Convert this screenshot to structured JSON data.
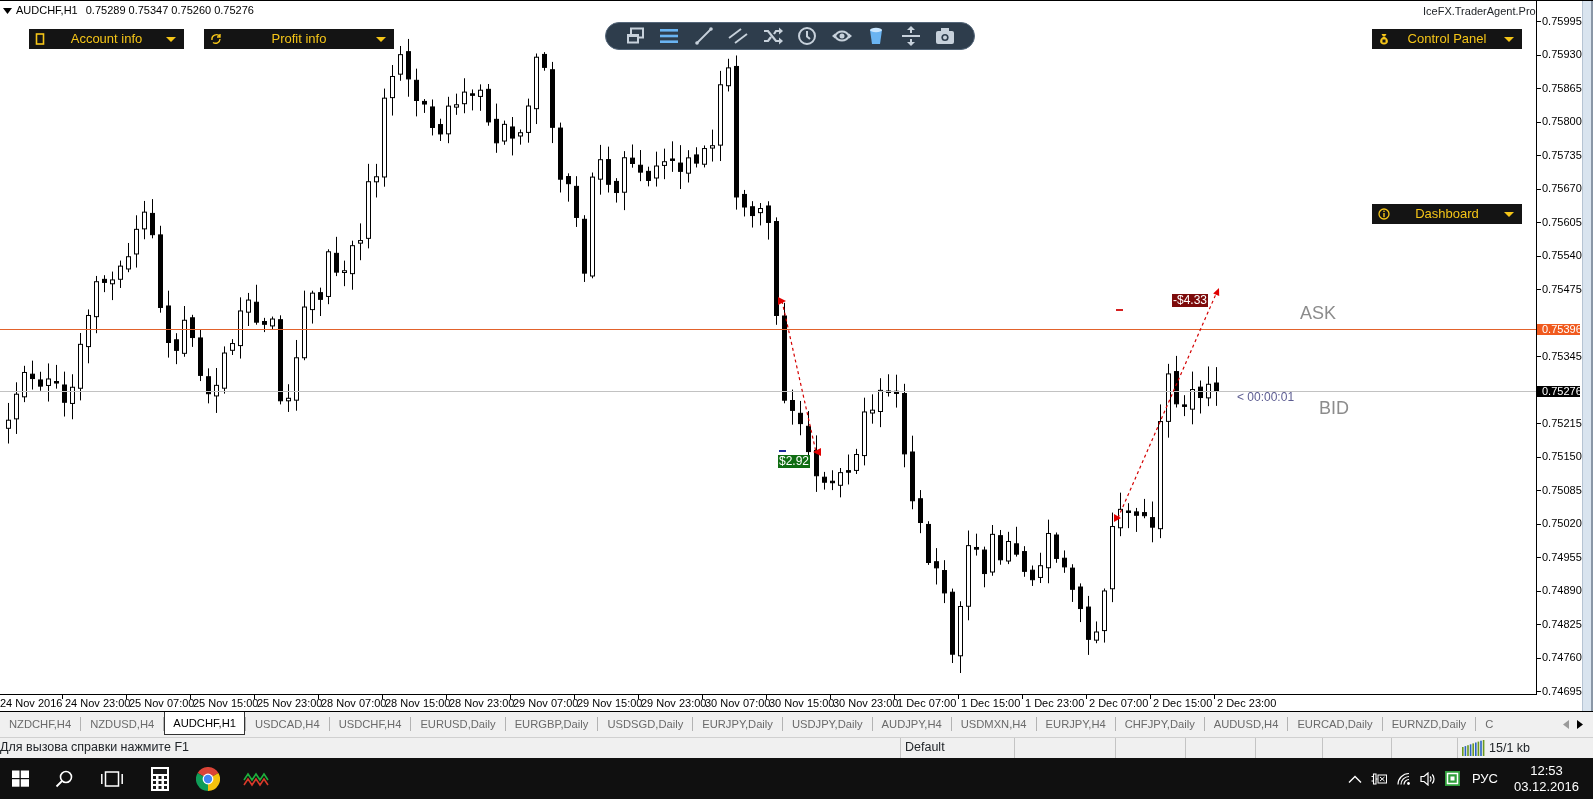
{
  "chart": {
    "symbol": "AUDCHF,H1",
    "quotes": [
      "0.75289",
      "0.75347",
      "0.75260",
      "0.75276"
    ],
    "left_panels": [
      {
        "label": "Account info"
      },
      {
        "label": "Profit info"
      }
    ],
    "toolbar": [
      {
        "active": false
      },
      {
        "active": true
      },
      {
        "active": false
      },
      {
        "active": false
      },
      {
        "active": false
      },
      {
        "active": false
      },
      {
        "active": false
      },
      {
        "active": true
      },
      {
        "active": false
      },
      {
        "active": false
      }
    ],
    "brand": "IceFX.TraderAgent.Pro",
    "right_panels": [
      {
        "label": "Control Panel"
      },
      {
        "label": "Dashboard"
      }
    ],
    "ask": {
      "label": "ASK",
      "price": "0.75396"
    },
    "bid": {
      "label": "BID",
      "price": "0.75276",
      "countdown": "< 00:00:01"
    },
    "trades": [
      {
        "profit": "$2.92",
        "color": "#0f6d12"
      },
      {
        "profit": "-$4.33",
        "color": "#7d0b0b"
      }
    ],
    "price_axis": [
      "0.75995",
      "0.75930",
      "0.75865",
      "0.75800",
      "0.75735",
      "0.75670",
      "0.75605",
      "0.75540",
      "0.75475",
      "0.75345",
      "0.75215",
      "0.75150",
      "0.75085",
      "0.75020",
      "0.74955",
      "0.74890",
      "0.74825",
      "0.74760",
      "0.74695"
    ],
    "time_axis": [
      "24 Nov 2016",
      "24 Nov 23:00",
      "25 Nov 07:00",
      "25 Nov 15:00",
      "25 Nov 23:00",
      "28 Nov 07:00",
      "28 Nov 15:00",
      "28 Nov 23:00",
      "29 Nov 07:00",
      "29 Nov 15:00",
      "29 Nov 23:00",
      "30 Nov 07:00",
      "30 Nov 15:00",
      "30 Nov 23:00",
      "1 Dec 07:00",
      "1 Dec 15:00",
      "1 Dec 23:00",
      "2 Dec 07:00",
      "2 Dec 15:00",
      "2 Dec 23:00"
    ]
  },
  "tabs": [
    {
      "label": "NZDCHF,H4",
      "selected": false
    },
    {
      "label": "NZDUSD,H4",
      "selected": false
    },
    {
      "label": "AUDCHF,H1",
      "selected": true
    },
    {
      "label": "USDCAD,H4",
      "selected": false
    },
    {
      "label": "USDCHF,H4",
      "selected": false
    },
    {
      "label": "EURUSD,Daily",
      "selected": false
    },
    {
      "label": "EURGBP,Daily",
      "selected": false
    },
    {
      "label": "USDSGD,Daily",
      "selected": false
    },
    {
      "label": "EURJPY,Daily",
      "selected": false
    },
    {
      "label": "USDJPY,Daily",
      "selected": false
    },
    {
      "label": "AUDJPY,H4",
      "selected": false
    },
    {
      "label": "USDMXN,H4",
      "selected": false
    },
    {
      "label": "EURJPY,H4",
      "selected": false
    },
    {
      "label": "CHFJPY,Daily",
      "selected": false
    },
    {
      "label": "AUDUSD,H4",
      "selected": false
    },
    {
      "label": "EURCAD,Daily",
      "selected": false
    },
    {
      "label": "EURNZD,Daily",
      "selected": false
    },
    {
      "label": "C",
      "selected": false
    }
  ],
  "status_bar": {
    "help": "Для вызова справки нажмите F1",
    "profile": "Default",
    "traffic": "15/1 kb"
  },
  "taskbar": {
    "language": "РУС",
    "time": "12:53",
    "date": "03.12.2016"
  }
}
